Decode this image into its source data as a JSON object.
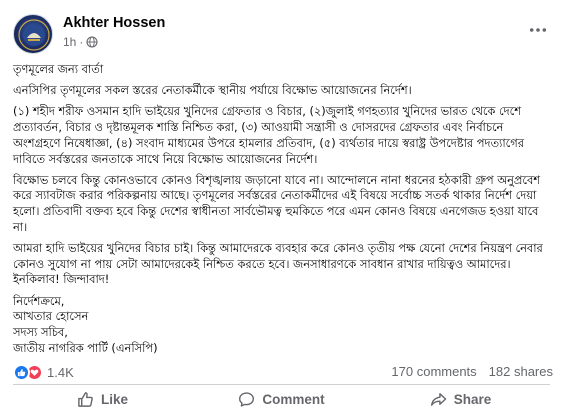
{
  "author": {
    "name": "Akhter Hossen",
    "time": "1h",
    "separator": "·",
    "audience_icon": "globe-icon"
  },
  "menu_icon": "more-icon",
  "post": {
    "paragraphs": [
      "তৃণমূলের জন্য বার্তা",
      "এনসিপির তৃণমূলের সকল স্তরের নেতাকর্মীকে স্থানীয় পর্যায়ে বিক্ষোভ আয়োজনের নির্দেশ।",
      "(১) শহীদ শরীফ ওসমান হাদি ভাইয়ের খুনিদের গ্রেফতার ও বিচার, (২)জুলাই গণহত্যার খুনিদের ভারত থেকে দেশে প্রত্যাবর্তন, বিচার ও দৃষ্টান্তমূলক শাস্তি নিশ্চিত করা, (৩) আওয়ামী সন্ত্রাসী ও দোসরদের গ্রেফতার এবং নির্বাচনে অংশগ্রহণে নিষেধাজ্ঞা, (৪) সংবাদ মাধ্যমের উপরে হামলার প্রতিবাদ, (৫) ব্যর্থতার দায়ে স্বরাষ্ট্র উপদেষ্টার পদত্যাগের দাবিতে সর্বস্তরের জনতাকে সাথে নিয়ে বিক্ষোভ আয়োজনের নির্দেশ।",
      "বিক্ষোভ চলবে কিন্তু কোনওভাবে কোনও বিশৃঙ্খলায় জড়ানো যাবে না। আন্দোলনে নানা ধরনের হঠকারী গ্রুপ অনুপ্রবেশ করে স্যাবটাজ করার পরিকল্পনায় আছে। তৃণমূলের সর্বস্তরের নেতাকর্মীদের এই বিষয়ে সর্বোচ্চ সতর্ক থাকার নির্দেশ দেয়া হলো। প্রতিবাদী বক্তব্য হবে কিন্তু দেশের স্বাধীনতা সার্বভৌমত্ব হুমকিতে পরে এমন কোনও বিষয়ে এনগেজড হওয়া যাবে না।",
      "আমরা হাদি ভাইয়ের খুনিদের বিচার চাই। কিন্তু আমাদেরকে ব্যবহার করে কোনও তৃতীয় পক্ষ যেনো দেশের নিয়ন্ত্রণ নেবার কোনও সুযোগ না পায় সেটা আমাদেরকেই নিশ্চিত করতে হবে। জনসাধারণকে সাবধান রাখার দায়িত্বও আমাদের। ইনকিলাব! জিন্দাবাদ!"
    ],
    "signature": [
      "নির্দেশক্রমে,",
      "আখতার হোসেন",
      "সদস্য সচিব,",
      "জাতীয় নাগরিক পার্টি (এনসিপি)"
    ]
  },
  "stats": {
    "reaction_icons": [
      "like-icon",
      "love-icon"
    ],
    "reaction_count": "1.4K",
    "comments": "170 comments",
    "shares": "182 shares"
  },
  "actions": {
    "like": "Like",
    "comment": "Comment",
    "share": "Share"
  },
  "colors": {
    "text": "#050505",
    "secondary": "#65676b",
    "like_blue": "#1877f2",
    "love_red": "#f33e58",
    "divider": "#ced0d4"
  }
}
